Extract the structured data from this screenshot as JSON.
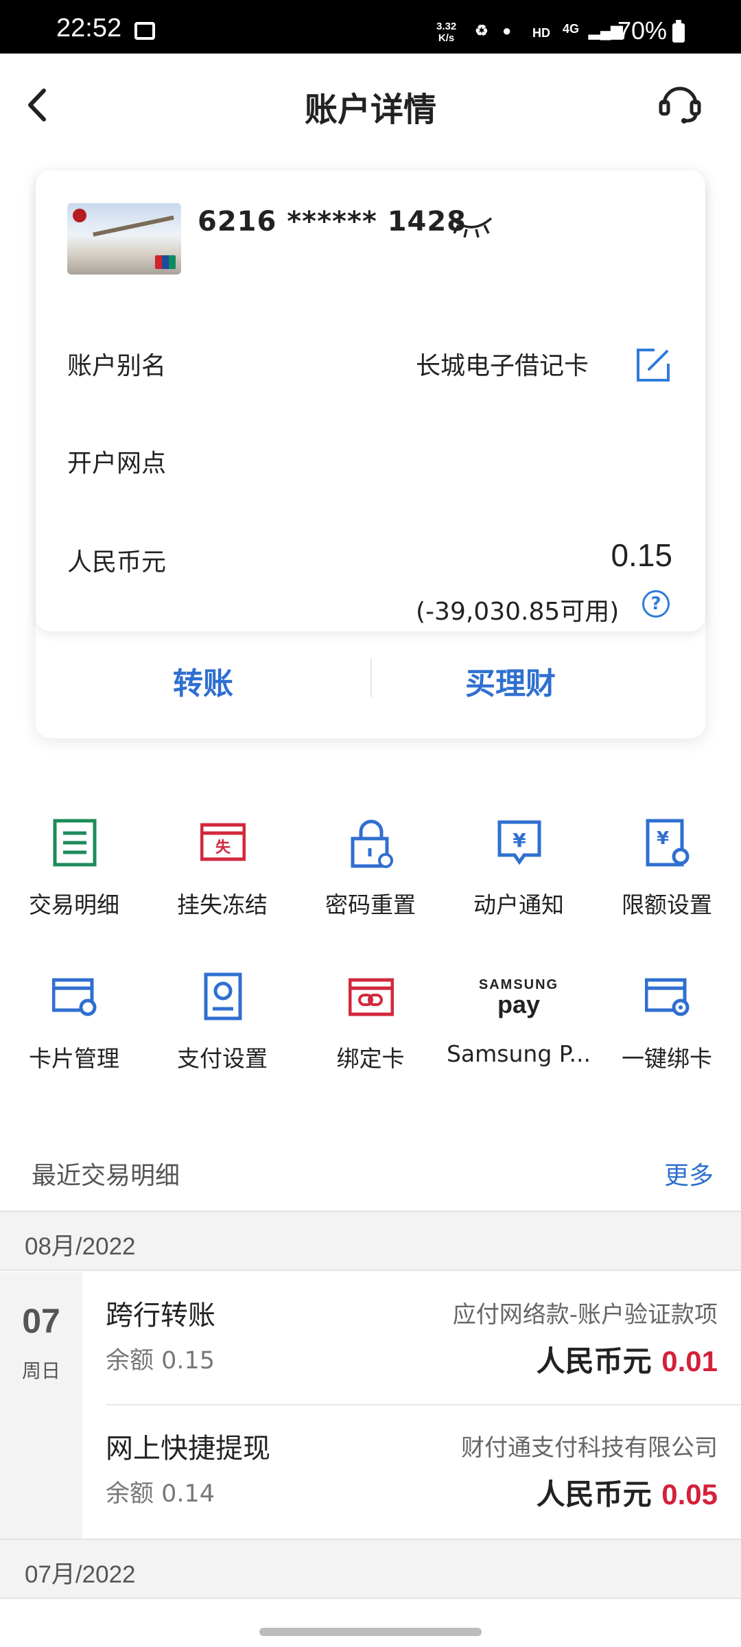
{
  "status_bar": {
    "time": "22:52",
    "net_speed": "3.32\nK/s",
    "hd": "HD",
    "network": "4G",
    "battery": "70%"
  },
  "header": {
    "title": "账户详情"
  },
  "account": {
    "card_number": "6216 ****** 1428",
    "alias_label": "账户别名",
    "alias_value": "长城电子借记卡",
    "branch_label": "开户网点",
    "currency_label": "人民币元",
    "balance": "0.15",
    "available": "(-39,030.85可用)",
    "help_symbol": "?"
  },
  "actions": {
    "transfer": "转账",
    "buy_wealth": "买理财"
  },
  "menu": [
    {
      "label": "交易明细",
      "icon": "transaction-detail-icon"
    },
    {
      "label": "挂失冻结",
      "icon": "report-loss-icon"
    },
    {
      "label": "密码重置",
      "icon": "password-reset-icon"
    },
    {
      "label": "动户通知",
      "icon": "account-notice-icon"
    },
    {
      "label": "限额设置",
      "icon": "limit-settings-icon"
    },
    {
      "label": "卡片管理",
      "icon": "card-management-icon"
    },
    {
      "label": "支付设置",
      "icon": "payment-settings-icon"
    },
    {
      "label": "绑定卡",
      "icon": "bind-card-icon"
    },
    {
      "label": "Samsung P...",
      "icon": "samsung-pay-icon",
      "logo_top": "SAMSUNG",
      "logo_bottom": "pay"
    },
    {
      "label": "一键绑卡",
      "icon": "one-click-bind-icon"
    }
  ],
  "recent": {
    "title": "最近交易明细",
    "more": "更多",
    "months": [
      "08月/2022",
      "07月/2022"
    ],
    "day": {
      "num": "07",
      "weekday": "周日"
    },
    "transactions": [
      {
        "name": "跨行转账",
        "balance": "余额 0.15",
        "party": "应付网络款-账户验证款项",
        "currency": "人民币元",
        "amount": "0.01"
      },
      {
        "name": "网上快捷提现",
        "balance": "余额 0.14",
        "party": "财付通支付科技有限公司",
        "currency": "人民币元",
        "amount": "0.05"
      }
    ]
  },
  "colors": {
    "accent_blue": "#2f6fd0",
    "amount_red": "#d4203a",
    "green_icon": "#1e8a5a",
    "red_icon": "#d2283c"
  }
}
